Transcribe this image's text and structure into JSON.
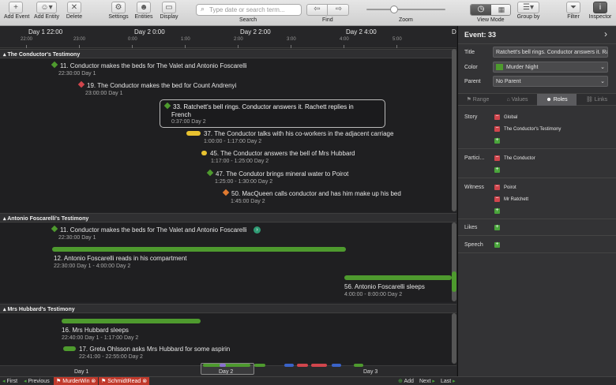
{
  "toolbar": {
    "add_event": "Add Event",
    "add_entity": "Add Entity",
    "delete": "Delete",
    "settings": "Settings",
    "entities": "Entities",
    "display": "Display",
    "search_placeholder": "Type date or search term...",
    "search_label": "Search",
    "find_label": "Find",
    "zoom_label": "Zoom",
    "zoom_level": 0.35,
    "view_mode": "View Mode",
    "group_by": "Group by",
    "filter": "Filter",
    "inspector": "Inspector"
  },
  "ruler": {
    "major": [
      "Day 1 22:00",
      "Day 2 0:00",
      "Day 2 2:00",
      "Day 2 4:00",
      "D"
    ],
    "minor": [
      "22:00",
      "23:00",
      "0:00",
      "1:00",
      "2:00",
      "3:00",
      "4:00",
      "5:00"
    ]
  },
  "sections": [
    {
      "title": "The Conductor's Testimony",
      "events": [
        {
          "title": "11. Conductor makes the beds for The Valet and Antonio Foscarelli",
          "date": "22:30:00 Day 1",
          "color": "#4e9a2e"
        },
        {
          "title": "19. The Conductor makes the bed for Count Andrenyi",
          "date": "23:00:00 Day 1",
          "color": "#d0454c"
        },
        {
          "title": "33. Ratchett's bell rings. Conductor answers it. Rachett replies in",
          "title2": "French",
          "date": "0:37:00 Day 2",
          "color": "#4e9a2e"
        },
        {
          "title": "37. The Conductor talks with his co-workers in the adjacent carriage",
          "date": "1:00:00 - 1:17:00 Day 2",
          "color": "#e8c230"
        },
        {
          "title": "45. The Conductor answers the bell of Mrs Hubbard",
          "date": "1:17:00 - 1:25:00 Day 2",
          "color": "#e8c230"
        },
        {
          "title": "47. The Condutor brings mineral water to Poirot",
          "date": "1:25:00 - 1:30:00 Day 2",
          "color": "#4e9a2e"
        },
        {
          "title": "50. MacQueen calls conductor and has him make up his bed",
          "date": "1:45:00 Day 2",
          "color": "#e07a30"
        }
      ]
    },
    {
      "title": "Antonio Foscarelli's Testimony",
      "events": [
        {
          "title": "11. Conductor makes the beds for The Valet and Antonio Foscarelli",
          "date": "22:30:00 Day 1",
          "color": "#4e9a2e"
        },
        {
          "title": "12. Antonio Foscarelli reads in his compartment",
          "date": "22:30:00 Day 1 - 4:00:00 Day 2",
          "color": "#4e9a2e"
        },
        {
          "title": "56. Antonio Foscarelli sleeps",
          "date": "4:00:00 - 8:00:00 Day 2",
          "color": "#4e9a2e"
        }
      ]
    },
    {
      "title": "Mrs Hubbard's Testimony",
      "events": [
        {
          "title": "16. Mrs Hubbard sleeps",
          "date": "22:40:00 Day 1 - 1:17:00 Day 2",
          "color": "#4e9a2e"
        },
        {
          "title": "17. Greta Ohlsson asks Mrs Hubbard for some aspirin",
          "date": "22:41:00 - 22:55:00 Day 2",
          "color": "#4e9a2e"
        }
      ]
    }
  ],
  "overview": {
    "day1": "Day 1",
    "day2": "Day 2",
    "day3": "Day 3"
  },
  "status": {
    "first": "First",
    "previous": "Previous",
    "tag1": "MurderWin",
    "tag2": "SchmidtRead",
    "add": "Add",
    "next": "Next",
    "last": "Last"
  },
  "inspector": {
    "header": "Event: 33",
    "title_label": "Title",
    "title_value": "Ratchett's bell rings. Conductor answers it. Rach",
    "color_label": "Color",
    "color_value": "Murder Night",
    "color_swatch": "#4e9a2e",
    "parent_label": "Parent",
    "parent_value": "No Parent",
    "tabs": [
      "Range",
      "Values",
      "Roles",
      "Links"
    ],
    "roles": [
      {
        "label": "Story",
        "values": [
          "Global",
          "The Conductor's Testimony"
        ]
      },
      {
        "label": "Partici...",
        "values": [
          "The Conductor"
        ]
      },
      {
        "label": "Witness",
        "values": [
          "Poirot",
          "Mr Ratchett"
        ]
      },
      {
        "label": "Likes",
        "values": []
      },
      {
        "label": "Speech",
        "values": []
      }
    ]
  }
}
